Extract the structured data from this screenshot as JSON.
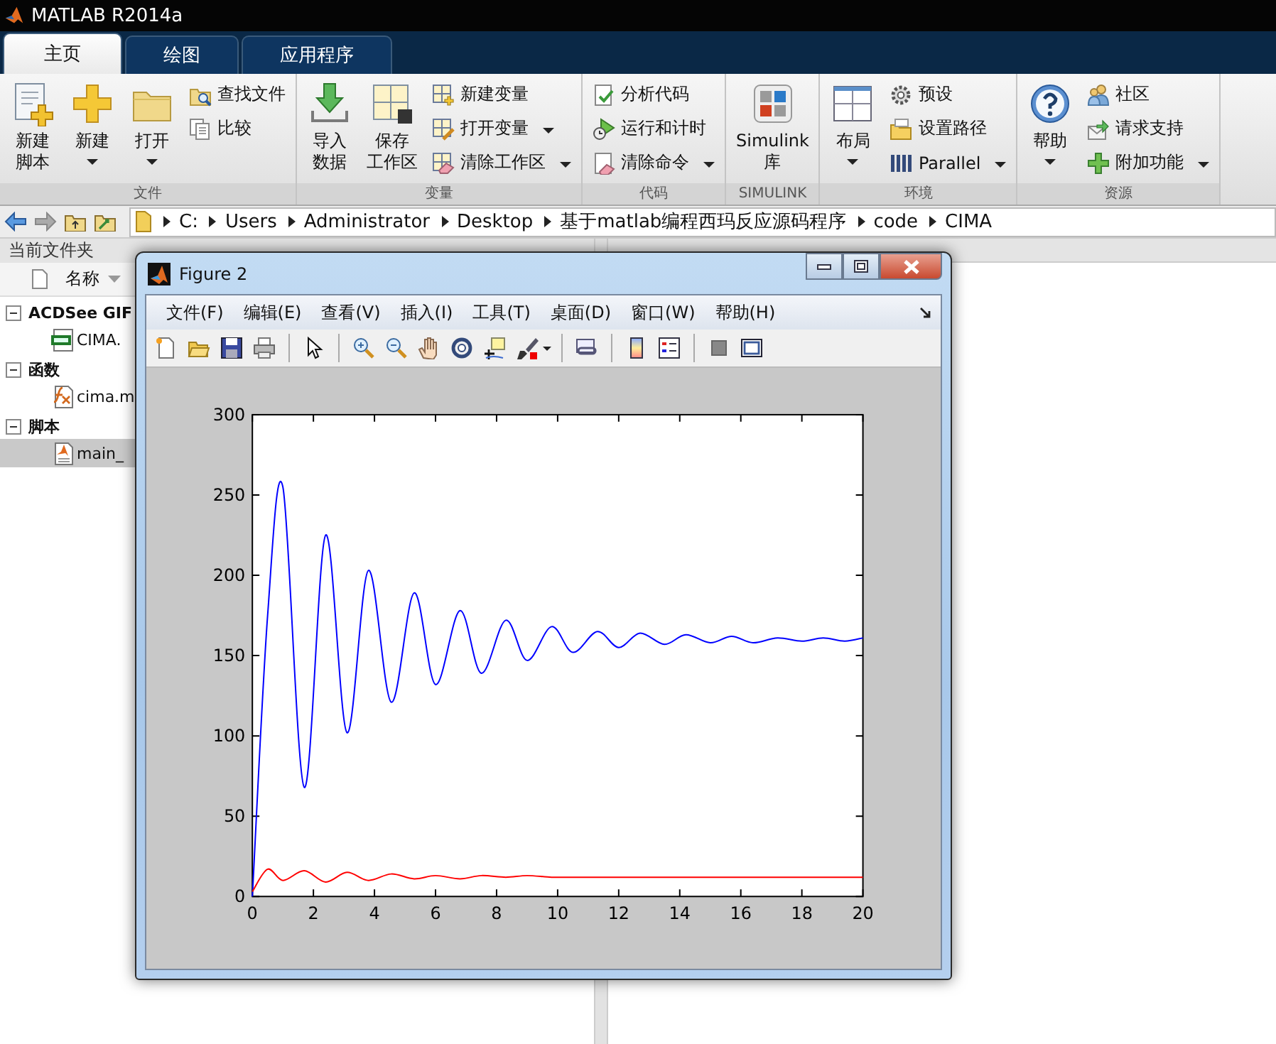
{
  "window": {
    "title": "MATLAB R2014a"
  },
  "tabs": [
    {
      "label": "主页",
      "selected": true
    },
    {
      "label": "绘图",
      "selected": false
    },
    {
      "label": "应用程序",
      "selected": false
    }
  ],
  "ribbon": {
    "groups": [
      {
        "label": "文件",
        "items": [
          {
            "kind": "large",
            "lines": [
              "新建",
              "脚本"
            ],
            "menu": false
          },
          {
            "kind": "large",
            "lines": [
              "新建"
            ],
            "menu": true
          },
          {
            "kind": "large",
            "lines": [
              "打开"
            ],
            "menu": true
          },
          {
            "kind": "small",
            "lines": [
              "查找文件"
            ],
            "menu": false
          },
          {
            "kind": "small",
            "lines": [
              "比较"
            ],
            "menu": false
          }
        ]
      },
      {
        "label": "变量",
        "items": [
          {
            "kind": "large",
            "lines": [
              "导入",
              "数据"
            ],
            "menu": false
          },
          {
            "kind": "large",
            "lines": [
              "保存",
              "工作区"
            ],
            "menu": false
          },
          {
            "kind": "small",
            "lines": [
              "新建变量"
            ],
            "menu": false
          },
          {
            "kind": "small",
            "lines": [
              "打开变量"
            ],
            "menu": true
          },
          {
            "kind": "small",
            "lines": [
              "清除工作区"
            ],
            "menu": true
          }
        ]
      },
      {
        "label": "代码",
        "items": [
          {
            "kind": "small",
            "lines": [
              "分析代码"
            ],
            "menu": false
          },
          {
            "kind": "small",
            "lines": [
              "运行和计时"
            ],
            "menu": false
          },
          {
            "kind": "small",
            "lines": [
              "清除命令"
            ],
            "menu": true
          }
        ]
      },
      {
        "label": "SIMULINK",
        "items": [
          {
            "kind": "large",
            "lines": [
              "Simulink",
              "库"
            ],
            "menu": false
          }
        ]
      },
      {
        "label": "环境",
        "items": [
          {
            "kind": "large",
            "lines": [
              "布局"
            ],
            "menu": true
          },
          {
            "kind": "small",
            "lines": [
              "预设"
            ],
            "menu": false
          },
          {
            "kind": "small",
            "lines": [
              "设置路径"
            ],
            "menu": false
          },
          {
            "kind": "small",
            "lines": [
              "Parallel"
            ],
            "menu": true
          }
        ]
      },
      {
        "label": "资源",
        "items": [
          {
            "kind": "large",
            "lines": [
              "帮助"
            ],
            "menu": true
          },
          {
            "kind": "small",
            "lines": [
              "社区"
            ],
            "menu": false
          },
          {
            "kind": "small",
            "lines": [
              "请求支持"
            ],
            "menu": false
          },
          {
            "kind": "small",
            "lines": [
              "附加功能"
            ],
            "menu": true
          }
        ]
      }
    ]
  },
  "address": {
    "crumbs": [
      "C:",
      "Users",
      "Administrator",
      "Desktop",
      "基于matlab编程西玛反应源码程序",
      "code",
      "CIMA"
    ]
  },
  "current_folder": {
    "title": "当前文件夹",
    "column": "名称",
    "groups": [
      {
        "label": "ACDSee GIF",
        "expanded": true,
        "children": [
          {
            "name": "CIMA.",
            "selected": false
          }
        ]
      },
      {
        "label": "函数",
        "expanded": true,
        "children": [
          {
            "name": "cima.m",
            "selected": false
          }
        ]
      },
      {
        "label": "脚本",
        "expanded": true,
        "children": [
          {
            "name": "main_",
            "selected": true
          }
        ]
      }
    ]
  },
  "figure": {
    "title": "Figure 2",
    "menus": [
      "文件(F)",
      "编辑(E)",
      "查看(V)",
      "插入(I)",
      "工具(T)",
      "桌面(D)",
      "窗口(W)",
      "帮助(H)"
    ],
    "chart_data": {
      "type": "line",
      "xlim": [
        0,
        20
      ],
      "ylim": [
        0,
        300
      ],
      "xticks": [
        0,
        2,
        4,
        6,
        8,
        10,
        12,
        14,
        16,
        18,
        20
      ],
      "yticks": [
        0,
        50,
        100,
        150,
        200,
        250,
        300
      ],
      "x": [
        0,
        0.5,
        1.0,
        1.7,
        2.4,
        3.1,
        3.8,
        4.55,
        5.3,
        6.0,
        6.8,
        7.5,
        8.3,
        9.0,
        9.8,
        10.5,
        11.3,
        12.0,
        12.7,
        13.5,
        14.2,
        15.0,
        15.7,
        16.4,
        17.2,
        18.0,
        18.7,
        19.4,
        20
      ],
      "series": [
        {
          "color": "#0000ff",
          "values": [
            0,
            175,
            255,
            68,
            225,
            102,
            203,
            121,
            189,
            132,
            178,
            139,
            172,
            147,
            168,
            152,
            165,
            155,
            164,
            157,
            163,
            158,
            162,
            158,
            161,
            159,
            161,
            159,
            161
          ]
        },
        {
          "color": "#ff0000",
          "values": [
            3,
            17,
            10,
            16,
            9,
            15,
            10,
            14,
            11,
            13,
            11,
            13,
            12,
            13,
            12,
            12,
            12,
            12,
            12,
            12,
            12,
            12,
            12,
            12,
            12,
            12,
            12,
            12,
            12
          ]
        }
      ]
    }
  }
}
